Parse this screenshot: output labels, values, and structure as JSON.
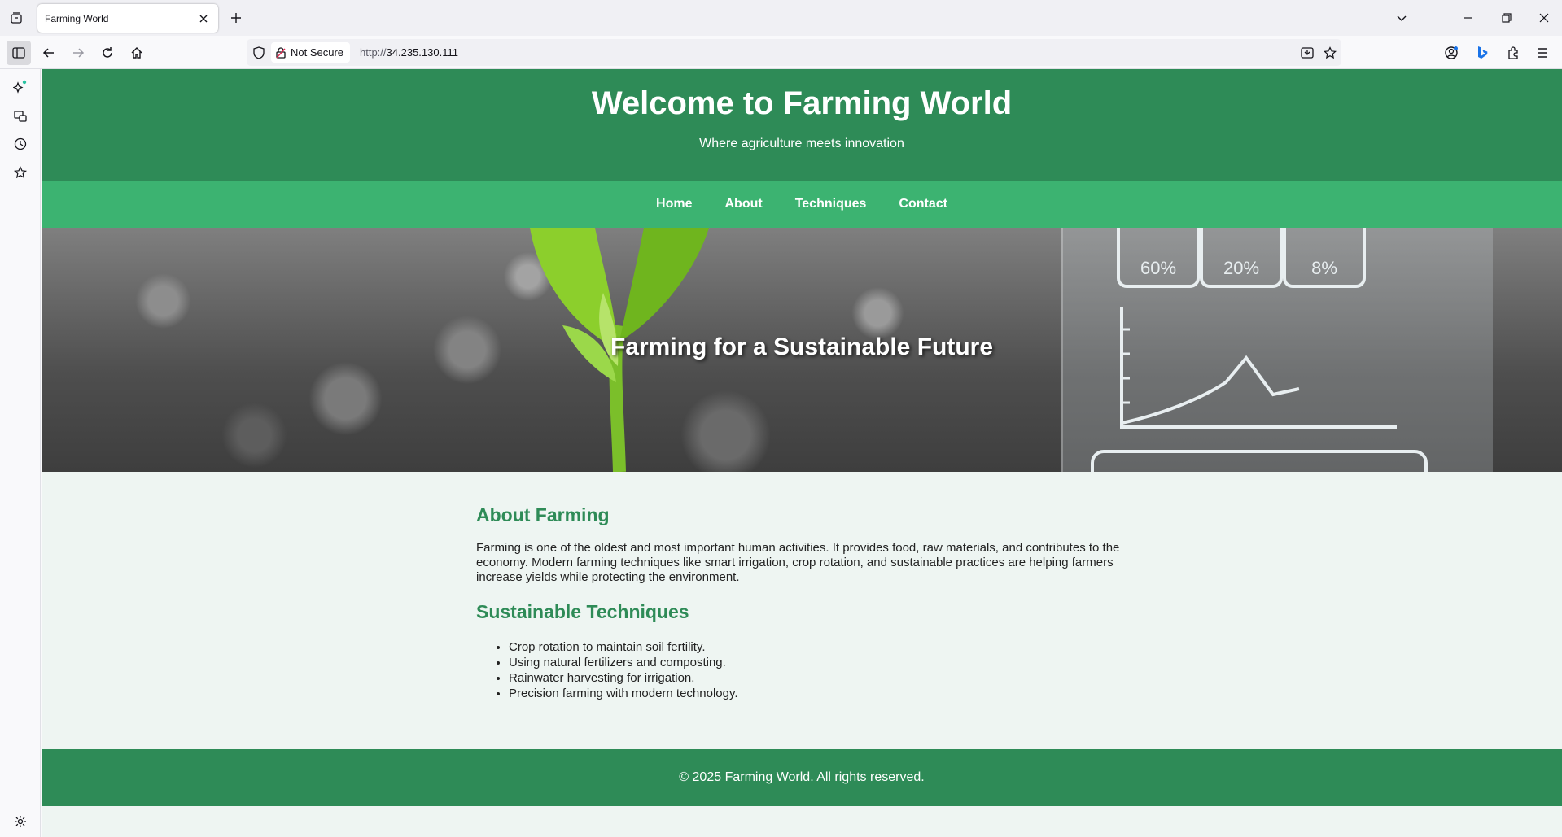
{
  "browser": {
    "tab_title": "Farming World",
    "url_security_label": "Not Secure",
    "url_scheme": "http://",
    "url_host": "34.235.130.111"
  },
  "page": {
    "header": {
      "title": "Welcome to Farming World",
      "subtitle": "Where agriculture meets innovation"
    },
    "nav": [
      {
        "label": "Home"
      },
      {
        "label": "About"
      },
      {
        "label": "Techniques"
      },
      {
        "label": "Contact"
      }
    ],
    "hero": {
      "title": "Farming for a Sustainable Future",
      "panel_labels": [
        "60%",
        "20%",
        "8%"
      ]
    },
    "about": {
      "heading": "About Farming",
      "body": "Farming is one of the oldest and most important human activities. It provides food, raw materials, and contributes to the economy. Modern farming techniques like smart irrigation, crop rotation, and sustainable practices are helping farmers increase yields while protecting the environment."
    },
    "techniques": {
      "heading": "Sustainable Techniques",
      "items": [
        "Crop rotation to maintain soil fertility.",
        "Using natural fertilizers and composting.",
        "Rainwater harvesting for irrigation.",
        "Precision farming with modern technology."
      ]
    },
    "footer": "© 2025 Farming World. All rights reserved."
  },
  "colors": {
    "header_green": "#2e8b57",
    "nav_green": "#3cb371",
    "page_bg": "#eef5f2"
  }
}
